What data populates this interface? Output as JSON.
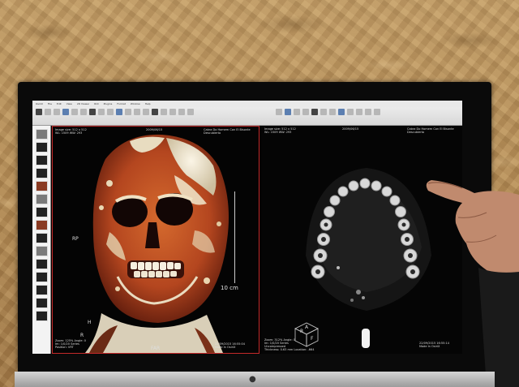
{
  "scene": {
    "description_label": "",
    "monitor": {
      "toolbar": {
        "menu_items": [
          "OsiriX",
          "File",
          "Edit",
          "View",
          "2D Viewer",
          "ROI",
          "Plugins",
          "Format",
          "Window",
          "Help"
        ]
      },
      "left_viewport": {
        "overlay_top_left": "Image size: 512 x 512\nWL: 1509 WW: 293",
        "overlay_top_center": "2009/06/15",
        "overlay_top_right": "Cabra Do Homem Con El Bisonte\nDescubierto",
        "overlay_bottom_left": "Zoom: 125% Angle: 0\nIm: 1/0/20 Series\nPosition: VRT",
        "overlay_bottom_right": "22/09/2015 16:55:04\nMade In OsiriX",
        "orientation_left": "RP",
        "orientation_bottom_left": "H",
        "orientation_bottom_left2": "R",
        "orientation_bottom_center": "FAR",
        "scale_bar_label": "10 cm"
      },
      "right_viewport": {
        "overlay_top_left": "Image size: 512 x 512\nWL: 1509 WW: 293",
        "overlay_top_center": "2009/06/15",
        "overlay_top_right": "Cabra Do Homem Con El Bisonte\nDescubierto",
        "overlay_bottom_left": "Zoom: 312% Angle: 0\nIm: 1/0/20 Series\nUncompressed\nThickness: 0.63 mm Location: -664",
        "overlay_bottom_right": "22/09/2015 16:55:14\nMade In OsiriX",
        "cube_labels": [
          "R",
          "A",
          "F"
        ]
      }
    }
  },
  "colors": {
    "wall": "#b08a55",
    "viewport_border": "#c42a2a",
    "bone": "#f0e6d0",
    "flesh_red": "#b4461f",
    "monitor_frame": "#0a0a0a"
  }
}
